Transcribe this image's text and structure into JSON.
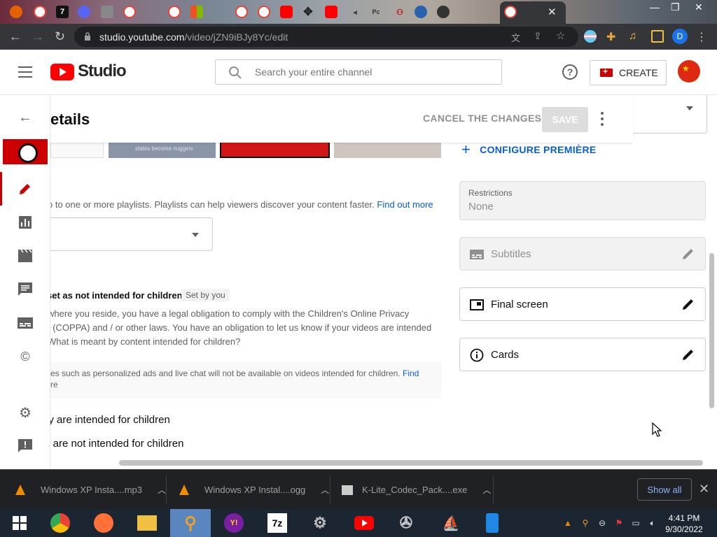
{
  "browser": {
    "url_host": "studio.youtube.com",
    "url_path": "/video/jZN9iBJy8Yc/edit",
    "profile_initial": "D",
    "tab_strip_icons": [
      "firefox-icon",
      "google-chrome-icon",
      "seven-icon",
      "discord-icon",
      "page-icon",
      "google-icon",
      "google-icon",
      "microsoft-icon",
      "google-icon",
      "google-icon",
      "youtube-icon",
      "move-icon",
      "youtube-icon",
      "audio-icon",
      "pc-icon",
      "game-icon",
      "globe-icon",
      "github-icon",
      "google-icon"
    ],
    "seven_label": "7"
  },
  "header": {
    "logo_text": "Studio",
    "search_placeholder": "Search your entire channel",
    "create_label": "CREATE"
  },
  "details": {
    "title": "etails",
    "cancel_label": "CANCEL THE CHANGES",
    "save_label": "SAVE",
    "thumb2_caption": "states become nuggets"
  },
  "playlist": {
    "description": "o to one or more playlists. Playlists can help viewers discover your content faster.",
    "link": "Find out more"
  },
  "audience": {
    "heading": "set as not intended for children",
    "badge": "Set by you",
    "line1": "where you reside, you have a legal obligation to comply with the Children's Online Privacy",
    "line2": "t (COPPA) and / or other laws. You have an obligation to let us know if your videos are intended",
    "link": "What is meant by content intended for children?",
    "note_line1": "es such as personalized ads and live chat will not be available on videos intended for children.",
    "note_link1": "Find",
    "note_link2": "re",
    "option_yes": "ey are intended for children",
    "option_no": "y are not intended for children"
  },
  "right": {
    "premiere_label": "CONFIGURE PREMIÈRE",
    "restrictions_label": "Restrictions",
    "restrictions_value": "None",
    "subtitles_label": "Subtitles",
    "final_screen_label": "Final screen",
    "cards_label": "Cards"
  },
  "downloads": {
    "items": [
      "Windows XP Insta....mp3",
      "Windows XP Instal....ogg",
      "K-Lite_Codec_Pack....exe"
    ],
    "show_all": "Show all"
  },
  "taskbar": {
    "time": "4:41 PM",
    "date": "9/30/2022",
    "seven_zip_label": "7z"
  },
  "colors": {
    "brand_red": "#ff0000",
    "link_blue": "#065fd4",
    "save_disabled": "#dddddd"
  }
}
